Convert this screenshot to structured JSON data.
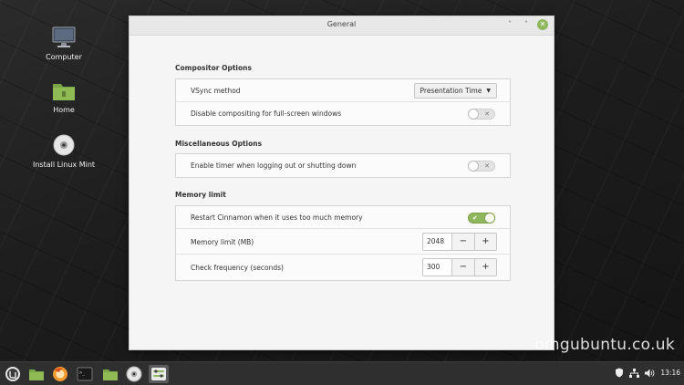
{
  "desktop": {
    "icons": [
      {
        "label": "Computer",
        "icon": "computer-icon"
      },
      {
        "label": "Home",
        "icon": "folder-icon"
      },
      {
        "label": "Install Linux Mint",
        "icon": "disc-icon"
      }
    ]
  },
  "window": {
    "title": "General",
    "controls": {
      "minimize": "˅",
      "maximize": "˄",
      "close": "✕"
    },
    "sections": {
      "compositor": {
        "title": "Compositor Options",
        "vsync_label": "VSync method",
        "vsync_value": "Presentation Time",
        "disable_compositing_label": "Disable compositing for full-screen windows",
        "disable_compositing_on": false
      },
      "misc": {
        "title": "Miscellaneous Options",
        "timer_label": "Enable timer when logging out or shutting down",
        "timer_on": false
      },
      "memory": {
        "title": "Memory limit",
        "restart_label": "Restart Cinnamon when it uses too much memory",
        "restart_on": true,
        "limit_label": "Memory limit (MB)",
        "limit_value": "2048",
        "frequency_label": "Check frequency (seconds)",
        "frequency_value": "300",
        "minus": "−",
        "plus": "+"
      }
    }
  },
  "watermark": "omgubuntu.co.uk",
  "taskbar": {
    "items": [
      "menu-icon",
      "files-icon",
      "firefox-icon",
      "terminal-icon",
      "folder-icon",
      "disc-icon",
      "settings-icon"
    ],
    "clock": "13:16"
  },
  "colors": {
    "accent": "#8fb75e",
    "window_bg": "#f5f5f5",
    "taskbar": "#2f2f2f"
  }
}
